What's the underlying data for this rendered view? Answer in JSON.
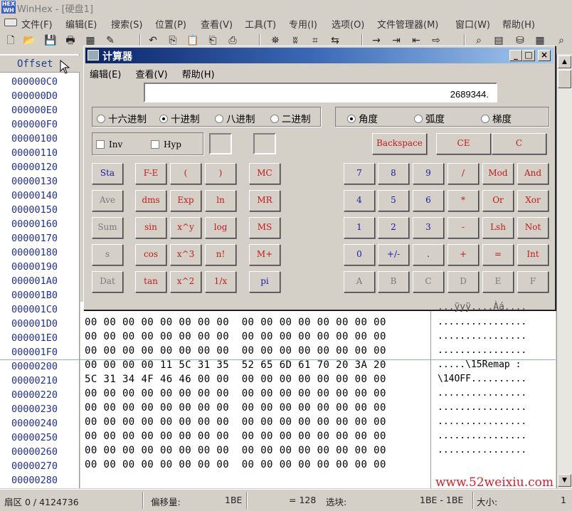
{
  "app": {
    "title": "WinHex - [硬盘1]",
    "icon_name": "winhex-app-icon"
  },
  "menubar": [
    "文件(F)",
    "编辑(E)",
    "搜索(S)",
    "位置(P)",
    "查看(V)",
    "工具(T)",
    "专用(I)",
    "选项(O)",
    "文件管理器(M)",
    "窗口(W)",
    "帮助(H)"
  ],
  "toolbar_icons": [
    "new-file-icon",
    "open-folder-icon",
    "save-disk-icon",
    "print-icon",
    "properties-icon",
    "wand-icon",
    "undo-icon",
    "copy-icon",
    "paste-icon",
    "paste-special-icon",
    "write-icon",
    "binoculars-icon",
    "find-text-icon",
    "find-hex-icon",
    "replace-icon",
    "goto-icon",
    "goto-offset-icon",
    "back-icon",
    "forward-icon",
    "search-disk-icon",
    "folder-list-icon",
    "disk-edit-icon",
    "calculator-icon",
    "magnifier-icon"
  ],
  "editor": {
    "offset_header": "Offset",
    "offsets": [
      "000000C0",
      "000000D0",
      "000000E0",
      "000000F0",
      "00000100",
      "00000110",
      "00000120",
      "00000130",
      "00000140",
      "00000150",
      "00000160",
      "00000170",
      "00000180",
      "00000190",
      "000001A0",
      "000001B0",
      "000001C0",
      "000001D0",
      "000001E0",
      "000001F0",
      "00000200",
      "00000210",
      "00000220",
      "00000230",
      "00000240",
      "00000250",
      "00000260",
      "00000270",
      "00000280"
    ],
    "visible_rows": [
      {
        "hex": "00 00 00 00 00 00 00 00  00 00 00 00 00 00 00 00",
        "ascii": "................"
      },
      {
        "hex": "00 00 00 00 00 00 00 00  00 00 00 00 00 00 00 00",
        "ascii": "................"
      },
      {
        "hex": "00 00 00 00 00 00 00 00  00 00 00 00 00 00 00 00",
        "ascii": "................"
      },
      {
        "hex": "00 00 00 00 11 5C 31 35  52 65 6D 61 70 20 3A 20",
        "ascii": ".....\\15Remap :"
      },
      {
        "hex": "5C 31 34 4F 46 46 00 00  00 00 00 00 00 00 00 00",
        "ascii": "\\14OFF.........."
      },
      {
        "hex": "00 00 00 00 00 00 00 00  00 00 00 00 00 00 00 00",
        "ascii": "................"
      },
      {
        "hex": "00 00 00 00 00 00 00 00  00 00 00 00 00 00 00 00",
        "ascii": "................"
      },
      {
        "hex": "00 00 00 00 00 00 00 00  00 00 00 00 00 00 00 00",
        "ascii": "................"
      },
      {
        "hex": "00 00 00 00 00 00 00 00  00 00 00 00 00 00 00 00",
        "ascii": "................"
      },
      {
        "hex": "00 00 00 00 00 00 00 00  00 00 00 00 00 00 00 00",
        "ascii": "................"
      },
      {
        "hex": "00 00 00 00 00 00 00 00  00 00 00 00 00 00 00 00",
        "ascii": ""
      }
    ],
    "partial_row_ascii": "...ÿyÿ....Àá...."
  },
  "calculator": {
    "title": "计算器",
    "window_buttons": [
      "_",
      "□",
      "×"
    ],
    "menu": [
      "编辑(E)",
      "查看(V)",
      "帮助(H)"
    ],
    "display": "2689344.",
    "radix": [
      "十六进制",
      "十进制",
      "八进制",
      "二进制"
    ],
    "radix_selected_index": 1,
    "angle": [
      "角度",
      "弧度",
      "梯度"
    ],
    "angle_selected_index": 0,
    "checks": [
      "Inv",
      "Hyp"
    ],
    "edit_buttons": [
      "Backspace",
      "CE",
      "C"
    ],
    "sci_rows": [
      [
        "Sta",
        "F-E",
        "(",
        ")"
      ],
      [
        "Ave",
        "dms",
        "Exp",
        "ln"
      ],
      [
        "Sum",
        "sin",
        "x^y",
        "log"
      ],
      [
        "s",
        "cos",
        "x^3",
        "n!"
      ],
      [
        "Dat",
        "tan",
        "x^2",
        "1/x"
      ]
    ],
    "mem_buttons": [
      "MC",
      "MR",
      "MS",
      "M+",
      "pi"
    ],
    "num_rows": [
      [
        "7",
        "8",
        "9",
        "/",
        "Mod",
        "And"
      ],
      [
        "4",
        "5",
        "6",
        "*",
        "Or",
        "Xor"
      ],
      [
        "1",
        "2",
        "3",
        "-",
        "Lsh",
        "Not"
      ],
      [
        "0",
        "+/-",
        ".",
        "+",
        "=",
        "Int"
      ],
      [
        "A",
        "B",
        "C",
        "D",
        "E",
        "F"
      ]
    ]
  },
  "status": {
    "sector": "扇区 0 / 4124736",
    "offset_label": "偏移量:",
    "offset_value": "1BE",
    "eq_value": "= 128",
    "block_label": "选块:",
    "block_value": "1BE - 1BE",
    "size_label": "大小:",
    "size_value": "1"
  },
  "watermark": "www.52weixiu.com"
}
